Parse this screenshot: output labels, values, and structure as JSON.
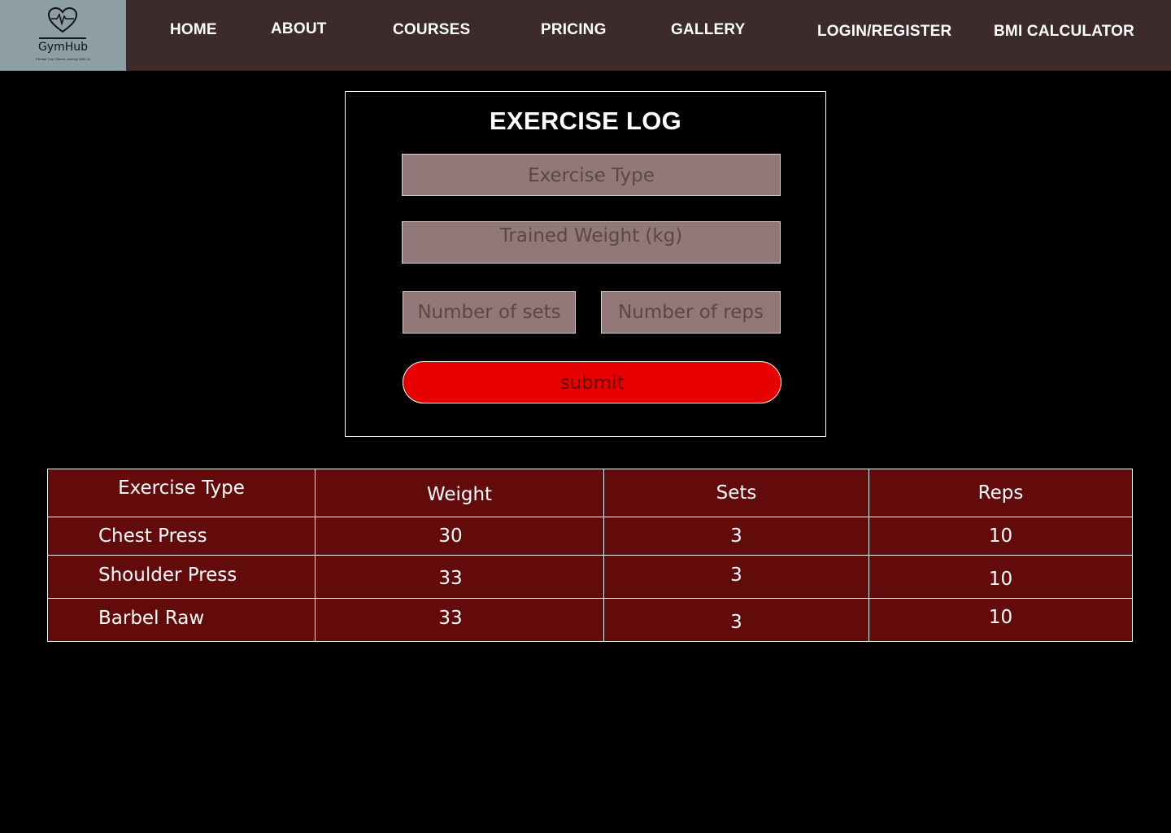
{
  "brand": {
    "name": "GymHub",
    "tagline": "Elevate Your Fitness Journey With Us",
    "logo_icon": "heart-pulse-icon",
    "logo_bg": "#8e9ea5"
  },
  "nav": {
    "items": [
      {
        "label": "HOME"
      },
      {
        "label": "ABOUT"
      },
      {
        "label": "COURSES"
      },
      {
        "label": "PRICING"
      },
      {
        "label": "GALLERY"
      },
      {
        "label": "LOGIN/REGISTER"
      },
      {
        "label": "BMI CALCULATOR"
      }
    ],
    "bg": "#3d2a2a"
  },
  "form": {
    "title": "EXERCISE LOG",
    "exercise_type_placeholder": "Exercise Type",
    "weight_placeholder": "Trained Weight (kg)",
    "sets_placeholder": "Number of sets",
    "reps_placeholder": "Number of reps",
    "submit_label": "submit",
    "field_color": "#927878",
    "submit_color": "#e60000"
  },
  "table": {
    "headers": [
      "Exercise Type",
      "Weight",
      "Sets",
      "Reps"
    ],
    "rows": [
      [
        "Chest Press",
        "30",
        "3",
        "10"
      ],
      [
        "Shoulder Press",
        "33",
        "3",
        "10"
      ],
      [
        "Barbel Raw",
        "33",
        "3",
        "10"
      ]
    ],
    "bg": "#630b0b"
  }
}
